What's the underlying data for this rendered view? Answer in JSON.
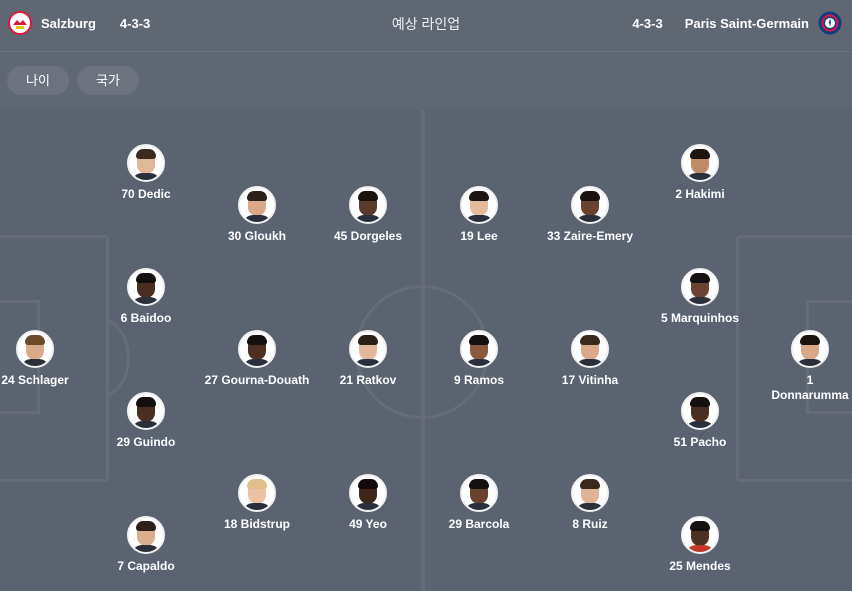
{
  "header": {
    "title": "예상 라인업",
    "home": {
      "name": "Salzburg",
      "formation": "4-3-3",
      "crest_icon": "salzburg-crest-icon",
      "crest_color": "#d8193b"
    },
    "away": {
      "name": "Paris Saint-Germain",
      "formation": "4-3-3",
      "crest_icon": "psg-crest-icon",
      "crest_color": "#0f3c82"
    }
  },
  "filters": {
    "age_label": "나이",
    "country_label": "국가"
  },
  "colors": {
    "background": "#5b6370",
    "pitch_lines": "#666d78",
    "chip": "#6c737e"
  },
  "players": {
    "dedic": "70 Dedic",
    "gloukh": "30 Gloukh",
    "dorgeles": "45 Dorgeles",
    "baidoo": "6 Baidoo",
    "schlager": "24 Schlager",
    "gourna": "27 Gourna-Douath",
    "ratkov": "21 Ratkov",
    "guindo": "29 Guindo",
    "bidstrup": "18 Bidstrup",
    "yeo": "49 Yeo",
    "capaldo": "7 Capaldo",
    "lee": "19 Lee",
    "zaire": "33 Zaire-Emery",
    "hakimi": "2 Hakimi",
    "marquinhos": "5 Marquinhos",
    "ramos": "9 Ramos",
    "vitinha": "17 Vitinha",
    "donnarumma": "1 Donnarumma",
    "pacho": "51 Pacho",
    "barcola": "29 Barcola",
    "ruiz": "8 Ruiz",
    "mendes": "25 Mendes"
  }
}
